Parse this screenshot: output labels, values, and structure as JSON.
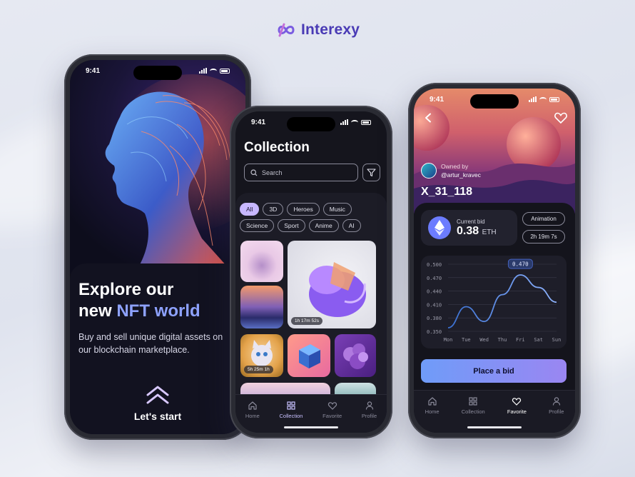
{
  "brand": {
    "name": "Interexy"
  },
  "colors": {
    "accent": "#8ea2ff",
    "chip_active": "#c7b7ff",
    "button_from": "#6f9cf8",
    "button_to": "#9a86f2",
    "background": "#e6e9f2"
  },
  "status_bar": {
    "time": "9:41"
  },
  "onboarding": {
    "title_line1": "Explore our",
    "title_line2_prefix": "new ",
    "title_highlight": "NFT world",
    "subtitle": "Buy and sell unique digital assets on our blockchain marketplace.",
    "cta_label": "Let's start",
    "cta_icon": "double-chevron-up-icon"
  },
  "collection": {
    "title": "Collection",
    "search_placeholder": "Search",
    "filters": [
      "All",
      "3D",
      "Heroes",
      "Music",
      "Science",
      "Sport",
      "Anime",
      "AI"
    ],
    "active_filter": "All",
    "tile_badges": {
      "large_tile": "1h 17m 52s",
      "cat_tile": "5h 25m 1h"
    }
  },
  "tabs": [
    {
      "label": "Home",
      "icon": "home-icon"
    },
    {
      "label": "Collection",
      "icon": "grid-icon"
    },
    {
      "label": "Favorite",
      "icon": "heart-icon"
    },
    {
      "label": "Profile",
      "icon": "user-icon"
    }
  ],
  "collection_active_tab": "Collection",
  "detail_active_tab": "Favorite",
  "nft_detail": {
    "owned_by_label": "Owned by",
    "owner_handle": "@artur_kravec",
    "name": "X_31_118",
    "current_bid_label": "Current bid",
    "current_bid_value": "0.38",
    "currency": "ETH",
    "category": "Animation",
    "time_left": "2h 19m 7s",
    "cta_label": "Place a bid"
  },
  "chart_data": {
    "type": "line",
    "categories": [
      "Mon",
      "Tue",
      "Wed",
      "Thu",
      "Fri",
      "Sat",
      "Sun"
    ],
    "series": [
      {
        "values": [
          0.358,
          0.405,
          0.372,
          0.432,
          0.476,
          0.448,
          0.415
        ]
      }
    ],
    "y_ticks": [
      "0.500",
      "0.470",
      "0.440",
      "0.410",
      "0.380",
      "0.350"
    ],
    "ylim": [
      0.35,
      0.5
    ],
    "highlight_label": "0.470",
    "grid": true
  }
}
